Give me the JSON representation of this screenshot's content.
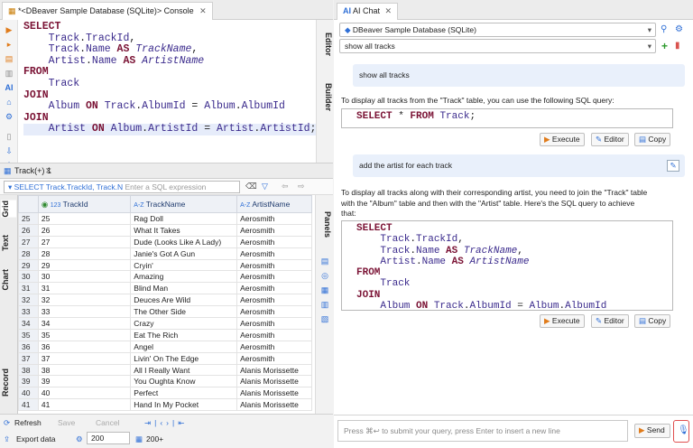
{
  "editor": {
    "tab_title": "*<DBeaver Sample Database (SQLite)> Console",
    "code": [
      [
        {
          "t": "SELECT",
          "c": "kw"
        }
      ],
      [
        {
          "t": "    Track",
          "c": "id"
        },
        {
          "t": ".",
          "c": ""
        },
        {
          "t": "TrackId",
          "c": "id"
        },
        {
          "t": ",",
          "c": ""
        }
      ],
      [
        {
          "t": "    Track",
          "c": "id"
        },
        {
          "t": ".",
          "c": ""
        },
        {
          "t": "Name ",
          "c": "id"
        },
        {
          "t": "AS ",
          "c": "kw"
        },
        {
          "t": "TrackName",
          "c": "it"
        },
        {
          "t": ",",
          "c": ""
        }
      ],
      [
        {
          "t": "    Artist",
          "c": "id"
        },
        {
          "t": ".",
          "c": ""
        },
        {
          "t": "Name ",
          "c": "id"
        },
        {
          "t": "AS ",
          "c": "kw"
        },
        {
          "t": "ArtistName",
          "c": "it"
        }
      ],
      [
        {
          "t": "FROM",
          "c": "kw"
        }
      ],
      [
        {
          "t": "    Track",
          "c": "id"
        }
      ],
      [
        {
          "t": "JOIN",
          "c": "kw"
        }
      ],
      [
        {
          "t": "    Album ",
          "c": "id"
        },
        {
          "t": "ON ",
          "c": "kw"
        },
        {
          "t": "Track",
          "c": "id"
        },
        {
          "t": ".",
          "c": ""
        },
        {
          "t": "AlbumId ",
          "c": "id"
        },
        {
          "t": "= ",
          "c": ""
        },
        {
          "t": "Album",
          "c": "id"
        },
        {
          "t": ".",
          "c": ""
        },
        {
          "t": "AlbumId",
          "c": "id"
        }
      ],
      [
        {
          "t": "JOIN",
          "c": "kw"
        }
      ],
      [
        {
          "t": "    Artist ",
          "c": "id"
        },
        {
          "t": "ON ",
          "c": "kw"
        },
        {
          "t": "Album",
          "c": "id"
        },
        {
          "t": ".",
          "c": ""
        },
        {
          "t": "ArtistId ",
          "c": "id"
        },
        {
          "t": "= ",
          "c": ""
        },
        {
          "t": "Artist",
          "c": "id"
        },
        {
          "t": ".",
          "c": ""
        },
        {
          "t": "ArtistId",
          "c": "id"
        },
        {
          "t": ";",
          "c": ""
        }
      ]
    ],
    "side_tabs": [
      "Editor",
      "Builder"
    ]
  },
  "results": {
    "tab_label": "Track(+) 1",
    "filter_text": "SELECT Track.TrackId, Track.N",
    "filter_placeholder": "Enter a SQL expression",
    "side_tabs": [
      "Grid",
      "Text",
      "Chart",
      "Record"
    ],
    "panels_label": "Panels",
    "columns": [
      "TrackId",
      "TrackName",
      "ArtistName"
    ],
    "col_type": [
      "123",
      "A-Z",
      "A-Z"
    ],
    "rows": [
      [
        "25",
        "25",
        "Rag Doll",
        "Aerosmith"
      ],
      [
        "26",
        "26",
        "What It Takes",
        "Aerosmith"
      ],
      [
        "27",
        "27",
        "Dude (Looks Like A Lady)",
        "Aerosmith"
      ],
      [
        "28",
        "28",
        "Janie's Got A Gun",
        "Aerosmith"
      ],
      [
        "29",
        "29",
        "Cryin'",
        "Aerosmith"
      ],
      [
        "30",
        "30",
        "Amazing",
        "Aerosmith"
      ],
      [
        "31",
        "31",
        "Blind Man",
        "Aerosmith"
      ],
      [
        "32",
        "32",
        "Deuces Are Wild",
        "Aerosmith"
      ],
      [
        "33",
        "33",
        "The Other Side",
        "Aerosmith"
      ],
      [
        "34",
        "34",
        "Crazy",
        "Aerosmith"
      ],
      [
        "35",
        "35",
        "Eat The Rich",
        "Aerosmith"
      ],
      [
        "36",
        "36",
        "Angel",
        "Aerosmith"
      ],
      [
        "37",
        "37",
        "Livin' On The Edge",
        "Aerosmith"
      ],
      [
        "38",
        "38",
        "All I Really Want",
        "Alanis Morissette"
      ],
      [
        "39",
        "39",
        "You Oughta Know",
        "Alanis Morissette"
      ],
      [
        "40",
        "40",
        "Perfect",
        "Alanis Morissette"
      ],
      [
        "41",
        "41",
        "Hand In My Pocket",
        "Alanis Morissette"
      ]
    ],
    "refresh_label": "Refresh",
    "save_label": "Save",
    "cancel_label": "Cancel",
    "export_label": "Export data",
    "fetch_size": "200",
    "row_count": "200+"
  },
  "ai_chat": {
    "tab_title": "AI Chat",
    "connection": "DBeaver Sample Database (SQLite)",
    "chat_select": "show all tracks",
    "user_msg_1": "show all tracks",
    "ai_msg_1": "To display all tracks from the \"Track\" table, you can use the following SQL query:",
    "code_1": [
      [
        {
          "t": "SELECT ",
          "c": "kw"
        },
        {
          "t": "* ",
          "c": ""
        },
        {
          "t": "FROM ",
          "c": "kw"
        },
        {
          "t": "Track",
          "c": "id"
        },
        {
          "t": ";",
          "c": ""
        }
      ]
    ],
    "user_msg_2": "add the artist for each track",
    "ai_msg_2_lines": [
      "To display all tracks along with their corresponding artist, you need to join the \"Track\" table",
      "with the \"Album\" table and then with the \"Artist\" table. Here's the SQL query to achieve",
      "that:"
    ],
    "code_2": [
      [
        {
          "t": "SELECT",
          "c": "kw"
        }
      ],
      [
        {
          "t": "    Track",
          "c": "id"
        },
        {
          "t": ".",
          "c": ""
        },
        {
          "t": "TrackId",
          "c": "id"
        },
        {
          "t": ",",
          "c": ""
        }
      ],
      [
        {
          "t": "    Track",
          "c": "id"
        },
        {
          "t": ".",
          "c": ""
        },
        {
          "t": "Name ",
          "c": "id"
        },
        {
          "t": "AS ",
          "c": "kw"
        },
        {
          "t": "TrackName",
          "c": "it"
        },
        {
          "t": ",",
          "c": ""
        }
      ],
      [
        {
          "t": "    Artist",
          "c": "id"
        },
        {
          "t": ".",
          "c": ""
        },
        {
          "t": "Name ",
          "c": "id"
        },
        {
          "t": "AS ",
          "c": "kw"
        },
        {
          "t": "ArtistName",
          "c": "it"
        }
      ],
      [
        {
          "t": "FROM",
          "c": "kw"
        }
      ],
      [
        {
          "t": "    Track",
          "c": "id"
        }
      ],
      [
        {
          "t": "JOIN",
          "c": "kw"
        }
      ],
      [
        {
          "t": "    Album ",
          "c": "id"
        },
        {
          "t": "ON ",
          "c": "kw"
        },
        {
          "t": "Track",
          "c": "id"
        },
        {
          "t": ".",
          "c": ""
        },
        {
          "t": "AlbumId ",
          "c": "id"
        },
        {
          "t": "= ",
          "c": ""
        },
        {
          "t": "Album",
          "c": "id"
        },
        {
          "t": ".",
          "c": ""
        },
        {
          "t": "AlbumId",
          "c": "id"
        }
      ]
    ],
    "execute_label": "Execute",
    "editor_label": "Editor",
    "copy_label": "Copy",
    "input_placeholder": "Press ⌘↩ to submit your query, press Enter to insert a new line",
    "send_label": "Send"
  },
  "colors": {
    "accent": "#2f6fd6",
    "keyword": "#7a1234",
    "identifier": "#3a2a8c"
  }
}
